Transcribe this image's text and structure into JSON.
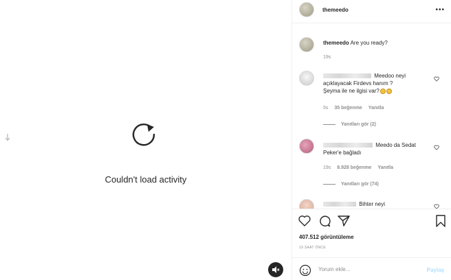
{
  "media": {
    "error_message": "Couldn't load activity",
    "icons": {
      "reload": "reload-icon",
      "mute": "speaker-muted-icon",
      "scroll": "arrow-down-icon"
    }
  },
  "header": {
    "username": "themeedo",
    "more": "•••"
  },
  "caption": {
    "username": "themeedo",
    "text": "Are you ready?",
    "age": "19s"
  },
  "comments": [
    {
      "username": "",
      "text_line1": "Meedoo neyi",
      "text_line2": "açıklayacak Firdevs hanım ?",
      "text_line3": "Şeyma ile ne ilgisi var?",
      "age": "5s",
      "likes": "35 beğenme",
      "reply": "Yanıtla",
      "view_replies": "Yanıtları gör (2)"
    },
    {
      "username": "",
      "text_line1": "Meedo da Sedat",
      "text_line2": "Peker'e bağladı",
      "age": "19s",
      "likes": "8.928 beğenme",
      "reply": "Yanıtla",
      "view_replies": "Yanıtları gör (74)"
    },
    {
      "username": "",
      "text_line1": "Bihter neyi"
    }
  ],
  "stats": {
    "views": "407.512 görüntüleme",
    "time": "19 SAAT ÖNCE"
  },
  "composer": {
    "placeholder": "Yorum ekle...",
    "share": "Paylaş"
  },
  "colors": {
    "text": "#262626",
    "muted": "#8e8e8e",
    "share_disabled": "#b2dffc",
    "divider": "#efefef"
  }
}
